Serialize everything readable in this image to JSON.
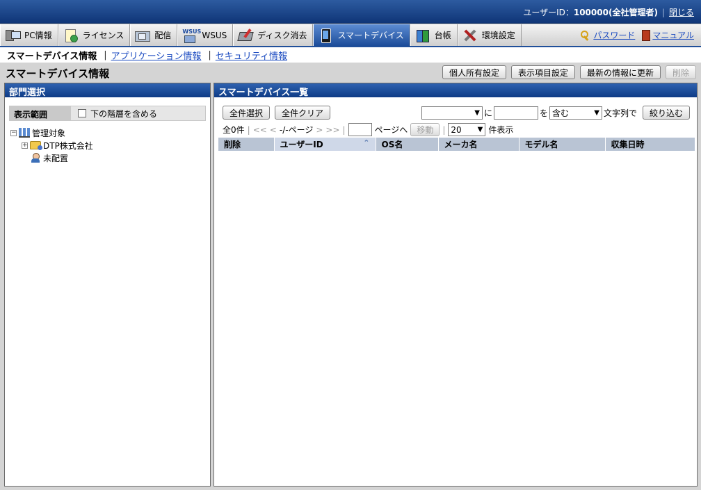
{
  "header": {
    "user_label": "ユーザーID：",
    "user_id": "100000(全社管理者)",
    "close_link": "閉じる"
  },
  "tabs": [
    {
      "label": "PC情報",
      "icon": "pc-icon"
    },
    {
      "label": "ライセンス",
      "icon": "license-icon"
    },
    {
      "label": "配信",
      "icon": "distribution-icon"
    },
    {
      "label": "WSUS",
      "icon": "wsus-icon"
    },
    {
      "label": "ディスク消去",
      "icon": "disk-erase-icon"
    },
    {
      "label": "スマートデバイス",
      "icon": "smart-device-icon",
      "active": true
    },
    {
      "label": "台帳",
      "icon": "ledger-icon"
    },
    {
      "label": "環境設定",
      "icon": "settings-tools-icon"
    }
  ],
  "tab_links": {
    "password": "パスワード",
    "manual": "マニュアル"
  },
  "subnav": {
    "current": "スマートデバイス情報",
    "app_info": "アプリケーション情報",
    "security_info": "セキュリティ情報"
  },
  "page": {
    "title": "スマートデバイス情報",
    "buttons": {
      "personal": "個人所有設定",
      "display_items": "表示項目設定",
      "refresh": "最新の情報に更新",
      "delete": "削除"
    }
  },
  "left_panel": {
    "title": "部門選択",
    "scope_label": "表示範囲",
    "include_lower": "下の階層を含める",
    "tree": {
      "root": "管理対象",
      "company": "DTP株式会社",
      "unassigned": "未配置"
    }
  },
  "right_panel": {
    "title": "スマートデバイス一覧",
    "select_all": "全件選択",
    "clear_all": "全件クリア",
    "filter": {
      "field_value": "",
      "ni": "に",
      "text_value": "",
      "wo": "を",
      "match_value": "含む",
      "suffix": "文字列で",
      "apply": "絞り込む"
    },
    "pager": {
      "total": "全0件",
      "first": "<<",
      "prev": "<",
      "page_info": "-/-ページ",
      "next": ">",
      "last": ">>",
      "page_input": "",
      "page_suffix": "ページへ",
      "move": "移動",
      "per_page": "20",
      "per_page_suffix": "件表示"
    },
    "columns": [
      "削除",
      "ユーザーID",
      "OS名",
      "メーカ名",
      "モデル名",
      "収集日時"
    ]
  }
}
